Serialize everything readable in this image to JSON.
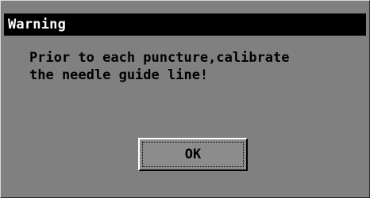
{
  "dialog": {
    "title": "Warning",
    "message_lines": [
      "Prior to each puncture,calibrate",
      "the needle guide line!"
    ],
    "ok_label": "OK"
  },
  "colors": {
    "title_bar": "#000000",
    "title_text": "#ffffff",
    "dialog_background": "#808080",
    "text": "#000000"
  }
}
